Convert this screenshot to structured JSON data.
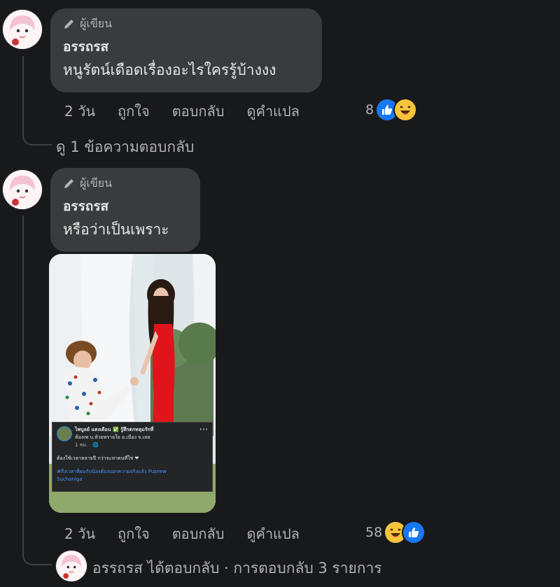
{
  "comments": [
    {
      "badge": "ผู้เขียน",
      "author": "อรรถรส",
      "text": "หนูรัตน์เดือดเรื่องอะไรใครรู้บ้างงง",
      "actions": {
        "time": "2 วัน",
        "like": "ถูกใจ",
        "reply": "ตอบกลับ",
        "translate": "ดูคำแปล"
      },
      "reaction_count": "8",
      "reactions": [
        "like-icon",
        "haha-icon"
      ],
      "view_replies": "ดู 1 ข้อความตอบกลับ"
    },
    {
      "badge": "ผู้เขียน",
      "author": "อรรถรส",
      "text": "หรือว่าเป็นเพราะ",
      "actions": {
        "time": "2 วัน",
        "like": "ถูกใจ",
        "reply": "ตอบกลับ",
        "translate": "ดูคำแปล"
      },
      "reaction_count": "58",
      "reactions": [
        "haha-icon",
        "like-icon"
      ],
      "attachment": {
        "post_card": {
          "line1": "ไพบูลย์ แสงเดือน ✅ รู้สึกตกหลุมรักที่",
          "line2": "ห้องเพ บ.ห้วยทรายใจ อ.เมือง จ.เลย",
          "time": "1 ชม. · 🌐",
          "body": "ต้องใช้เวลาหลายปี กว่าจะหาคนที่ใช่ ❤",
          "hashtag": "#ถึงเวลาที่ผมกับน้องต้องบอกความจริงแล้ว Puprew",
          "hashtag2": "Suchaniga"
        }
      },
      "replies_summary": "อรรถรส ได้ตอบกลับ · การตอบกลับ 3 รายการ"
    }
  ],
  "colors": {
    "background": "#18191a",
    "bubble": "#3a3b3c",
    "like": "#1877f2",
    "haha": "#f7c43b"
  }
}
